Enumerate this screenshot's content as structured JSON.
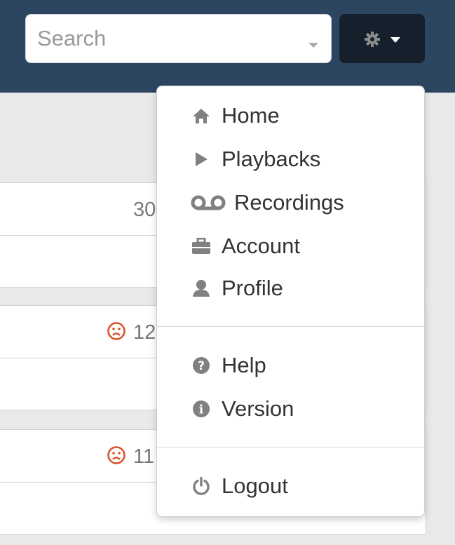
{
  "topbar": {
    "search": {
      "placeholder": "Search",
      "value": ""
    },
    "settings_button": {
      "icon": "gear-icon",
      "caret_icon": "caret-down-icon"
    }
  },
  "table": {
    "rows": [
      {
        "value": "30",
        "status_icon": ""
      },
      {
        "value": "12",
        "status_icon": "sad-face-icon"
      },
      {
        "value": "11",
        "status_icon": "sad-face-icon"
      }
    ]
  },
  "dropdown_menu": {
    "group1": [
      {
        "label": "Home",
        "icon": "home-icon"
      },
      {
        "label": "Playbacks",
        "icon": "play-icon"
      },
      {
        "label": "Recordings",
        "icon": "voicemail-icon"
      },
      {
        "label": "Account",
        "icon": "briefcase-icon"
      },
      {
        "label": "Profile",
        "icon": "user-icon"
      }
    ],
    "group2": [
      {
        "label": "Help",
        "icon": "question-circle-icon"
      },
      {
        "label": "Version",
        "icon": "info-circle-icon"
      }
    ],
    "group3": [
      {
        "label": "Logout",
        "icon": "power-icon"
      }
    ]
  },
  "colors": {
    "topbar": "#2c4560",
    "button": "#16202c",
    "icon_gray": "#808080",
    "sad_face": "#d9532b"
  }
}
